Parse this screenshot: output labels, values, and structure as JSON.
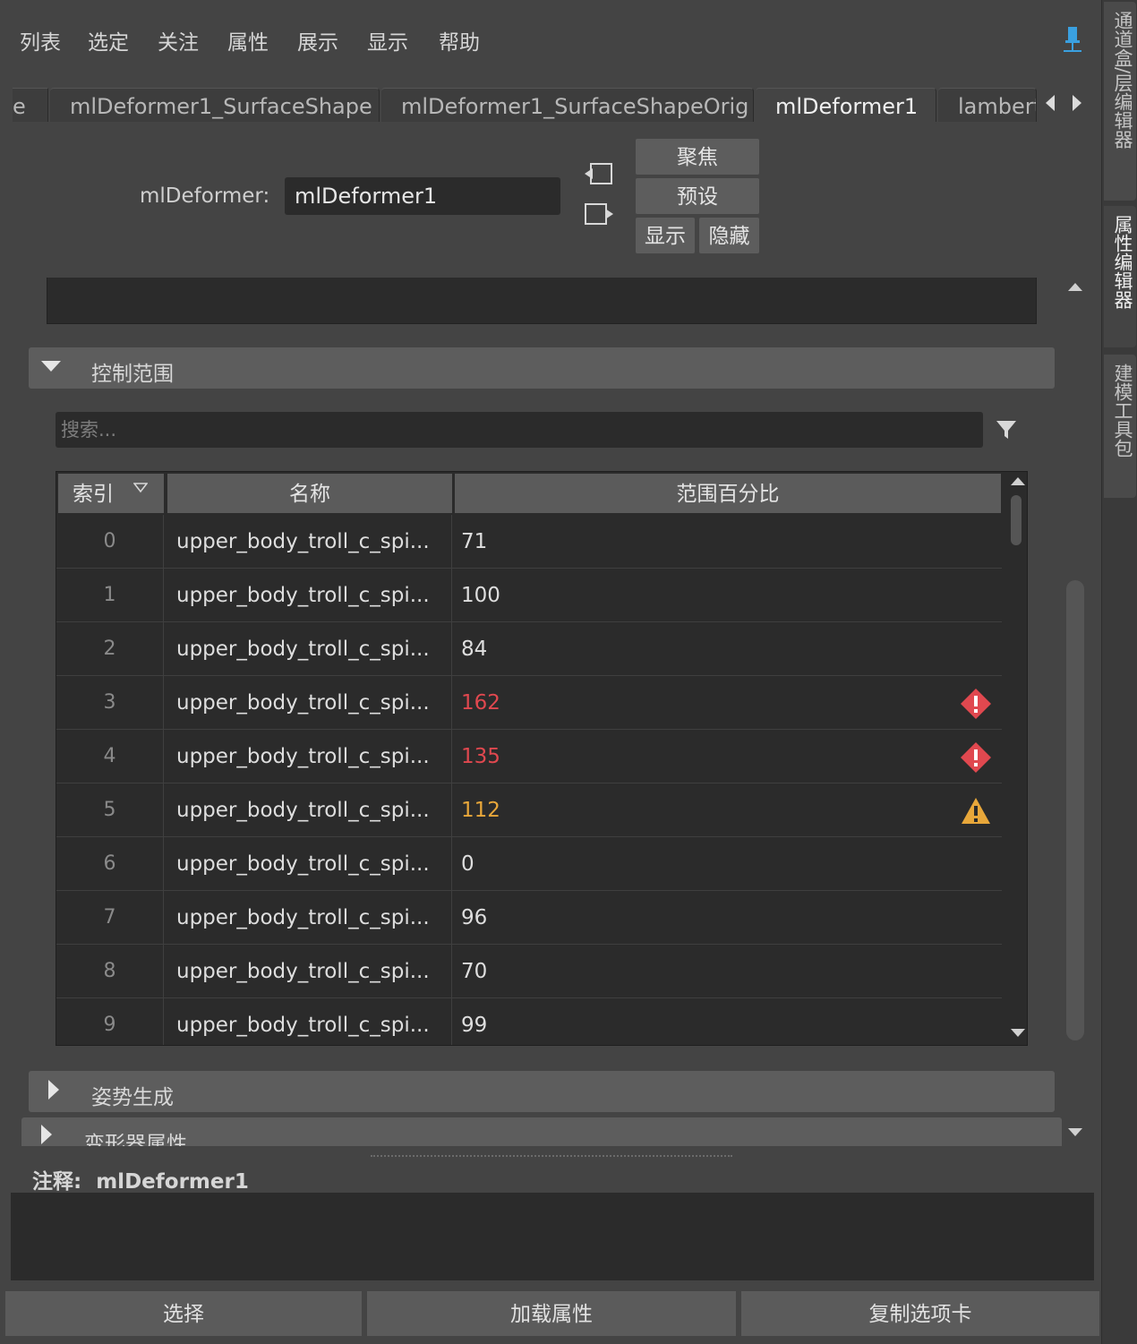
{
  "menu": [
    "列表",
    "选定",
    "关注",
    "属性",
    "展示",
    "显示",
    "帮助"
  ],
  "tabs": {
    "partial_left": "e",
    "items": [
      "mlDeformer1_SurfaceShape",
      "mlDeformer1_SurfaceShapeOrig",
      "mlDeformer1",
      "lambert"
    ],
    "active": "mlDeformer1"
  },
  "header": {
    "label": "mlDeformer:",
    "value": "mlDeformer1",
    "buttons": {
      "focus": "聚焦",
      "presets": "预设",
      "show": "显示",
      "hide": "隐藏"
    }
  },
  "sections": {
    "control_range": "控制范围",
    "pose_generation": "姿势生成",
    "deformer_attrs": "变形器属性"
  },
  "search": {
    "placeholder": "搜索..."
  },
  "table": {
    "columns": [
      "索引",
      "名称",
      "范围百分比"
    ],
    "rows": [
      {
        "index": "0",
        "name": "upper_body_troll_c_spi...",
        "value": "71",
        "status": "normal"
      },
      {
        "index": "1",
        "name": "upper_body_troll_c_spi...",
        "value": "100",
        "status": "normal"
      },
      {
        "index": "2",
        "name": "upper_body_troll_c_spi...",
        "value": "84",
        "status": "normal"
      },
      {
        "index": "3",
        "name": "upper_body_troll_c_spi...",
        "value": "162",
        "status": "error"
      },
      {
        "index": "4",
        "name": "upper_body_troll_c_spi...",
        "value": "135",
        "status": "error"
      },
      {
        "index": "5",
        "name": "upper_body_troll_c_spi...",
        "value": "112",
        "status": "warning"
      },
      {
        "index": "6",
        "name": "upper_body_troll_c_spi...",
        "value": "0",
        "status": "normal"
      },
      {
        "index": "7",
        "name": "upper_body_troll_c_spi...",
        "value": "96",
        "status": "normal"
      },
      {
        "index": "8",
        "name": "upper_body_troll_c_spi...",
        "value": "70",
        "status": "normal"
      },
      {
        "index": "9",
        "name": "upper_body_troll_c_spi...",
        "value": "99",
        "status": "normal"
      }
    ]
  },
  "colors": {
    "normal": "#dedede",
    "error": "#e0484f",
    "warning": "#e8a73a",
    "pin": "#3aa0e0"
  },
  "notes": {
    "label": "注释:",
    "node": "mlDeformer1"
  },
  "bottom_buttons": [
    "选择",
    "加载属性",
    "复制选项卡"
  ],
  "side_tabs": [
    "通道盒/层编辑器",
    "属性编辑器",
    "建模工具包"
  ]
}
